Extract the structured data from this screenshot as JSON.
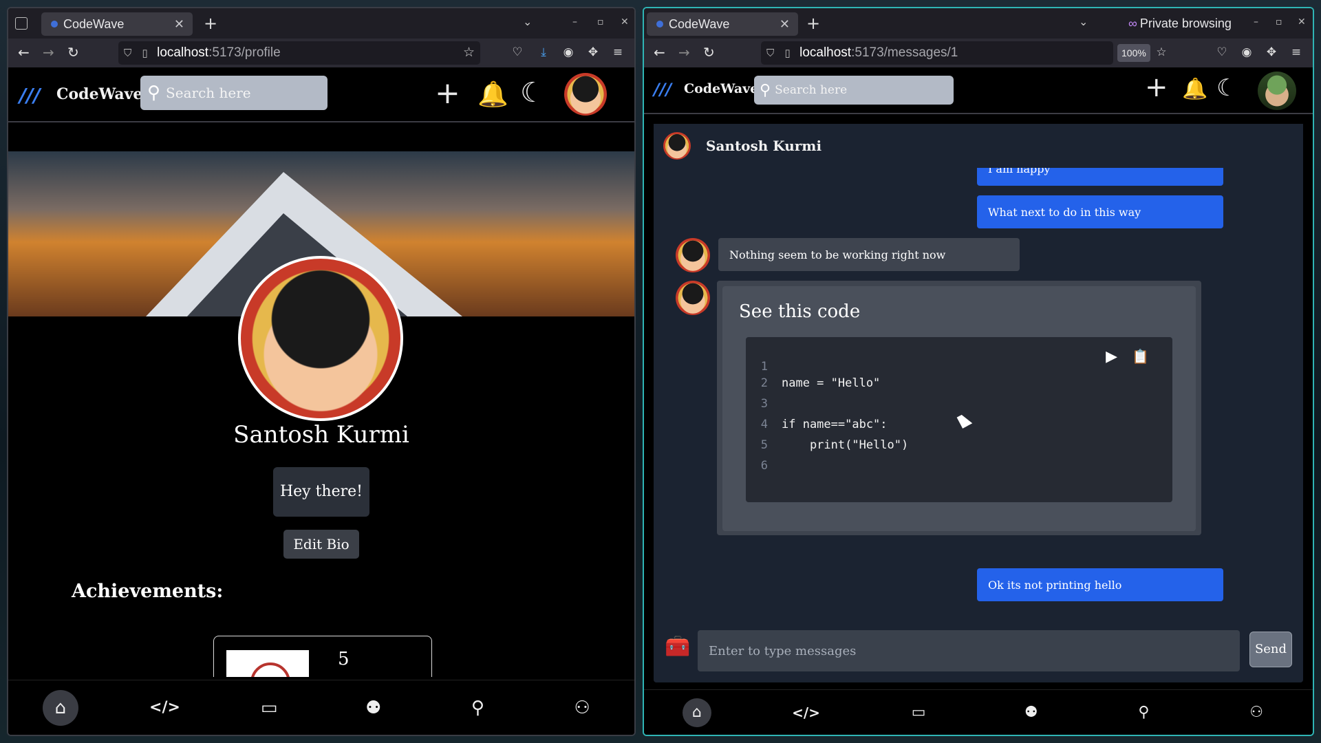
{
  "left_window": {
    "tab": {
      "title": "CodeWave"
    },
    "url": {
      "host": "localhost",
      "path": ":5173/profile"
    },
    "app": {
      "brand": "CodeWave",
      "search_placeholder": "Search here"
    },
    "profile": {
      "name": "Santosh Kurmi",
      "bio": "Hey there!",
      "edit_bio_label": "Edit Bio",
      "achievements_title": "Achievements:",
      "achievement_count": "5"
    },
    "bottom_nav": [
      {
        "icon": "home-icon",
        "glyph": "⌂"
      },
      {
        "icon": "code-icon",
        "glyph": "</>"
      },
      {
        "icon": "chat-icon",
        "glyph": "🗨"
      },
      {
        "icon": "users-icon",
        "glyph": "👥"
      },
      {
        "icon": "search-icon",
        "glyph": "🔍"
      },
      {
        "icon": "people-connect-icon",
        "glyph": "⚇"
      }
    ]
  },
  "right_window": {
    "tab": {
      "title": "CodeWave"
    },
    "private_label": "Private browsing",
    "url": {
      "host": "localhost",
      "path": ":5173/messages/1"
    },
    "zoom": "100%",
    "app": {
      "brand": "CodeWave",
      "search_placeholder": "Search here"
    },
    "chat": {
      "contact_name": "Santosh Kurmi",
      "messages": [
        {
          "from": "me",
          "text": "I am happy"
        },
        {
          "from": "me",
          "text": "What next to do in this way"
        },
        {
          "from": "them",
          "text": "Nothing seem to be working right now"
        },
        {
          "from": "them",
          "type": "code",
          "title": "See this code"
        },
        {
          "from": "me",
          "text": "Ok its not printing hello"
        }
      ],
      "code_lines": [
        {
          "n": "1",
          "text": ""
        },
        {
          "n": "2",
          "text": "name = \"Hello\""
        },
        {
          "n": "3",
          "text": ""
        },
        {
          "n": "4",
          "text": "if name==\"abc\":"
        },
        {
          "n": "5",
          "text": "    print(\"Hello\")"
        },
        {
          "n": "6",
          "text": ""
        }
      ],
      "input_placeholder": "Enter to type messages",
      "send_label": "Send"
    }
  },
  "colors": {
    "accent_blue": "#2462ea",
    "panel": "#1b2331",
    "bubble_them": "#3e444f"
  }
}
